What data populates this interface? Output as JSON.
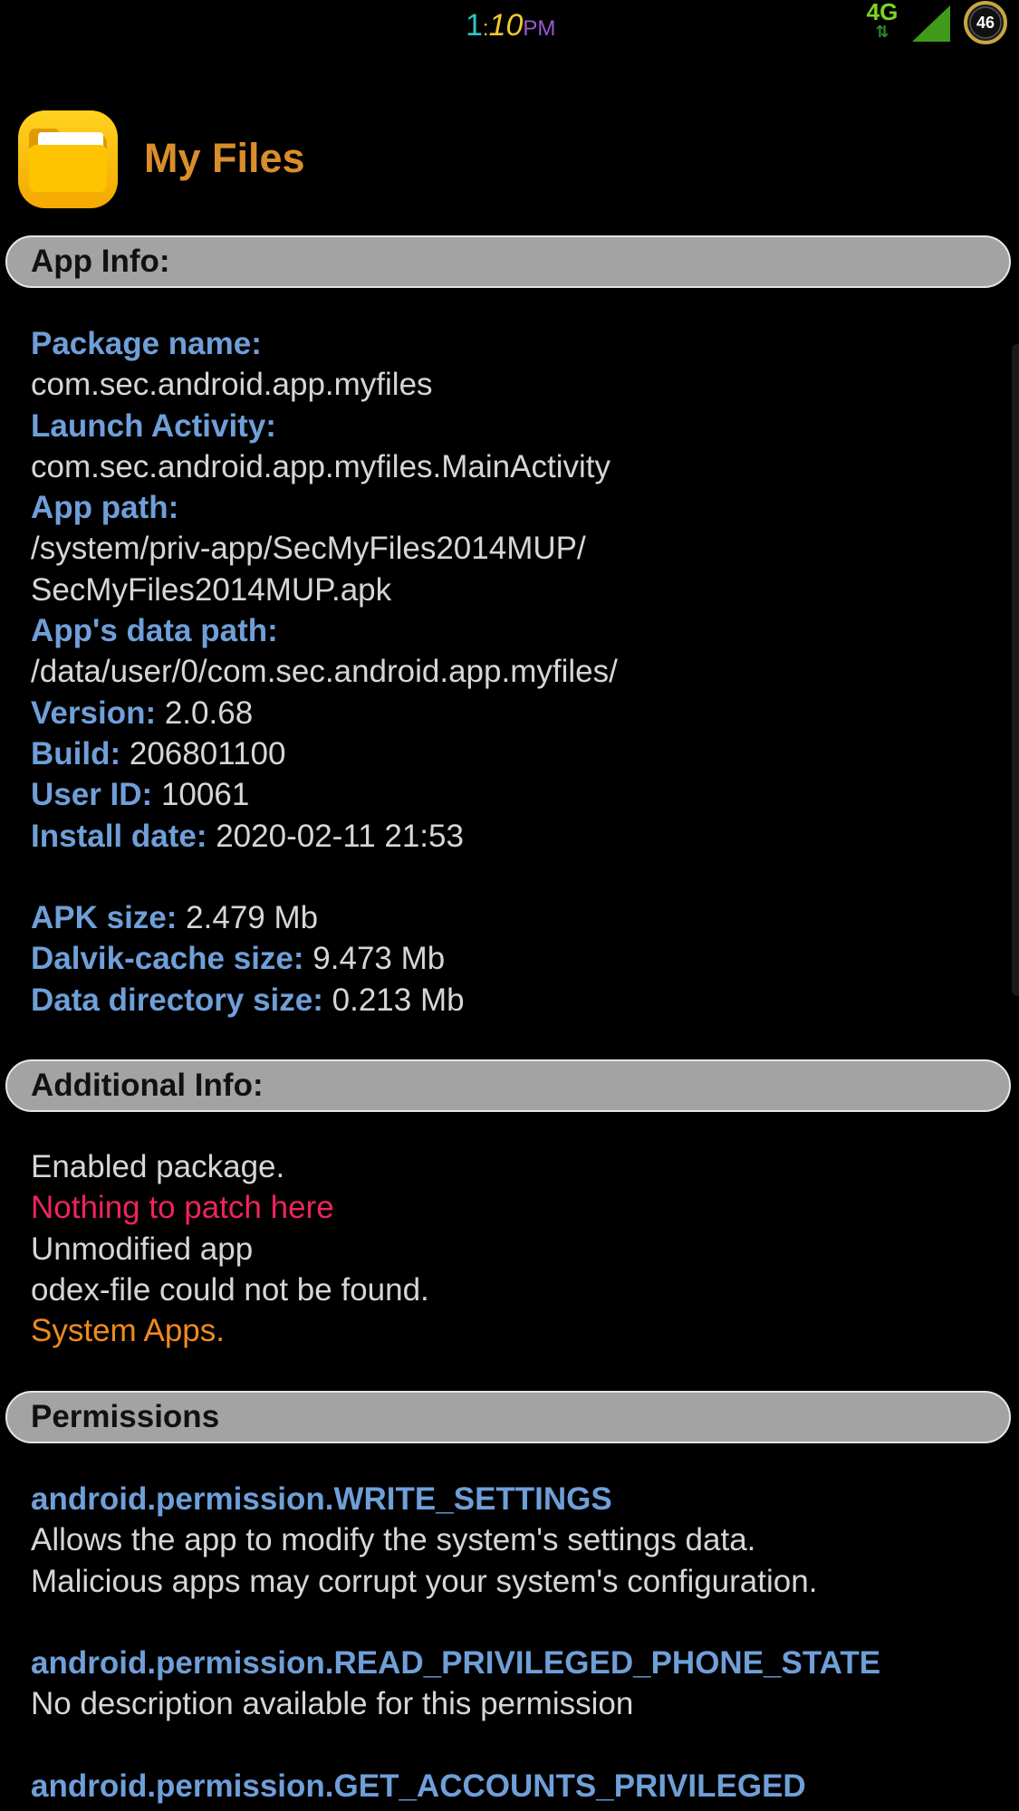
{
  "status_bar": {
    "clock_hour": "1",
    "clock_colon": ":",
    "clock_minute": "10",
    "clock_ampm": "PM",
    "network_type": "4G",
    "network_activity": "⇅",
    "battery_level": "46"
  },
  "app": {
    "name": "My Files",
    "icon": "folder-icon"
  },
  "app_info": {
    "section_title": "App Info:",
    "package_name_label": "Package name:",
    "package_name": "com.sec.android.app.myfiles",
    "launch_activity_label": "Launch Activity:",
    "launch_activity": "com.sec.android.app.myfiles.MainActivity",
    "app_path_label": "App path:",
    "app_path_line1": "/system/priv-app/SecMyFiles2014MUP/",
    "app_path_line2": "SecMyFiles2014MUP.apk",
    "data_path_label": "App's data path:",
    "data_path": "/data/user/0/com.sec.android.app.myfiles/",
    "version_label": "Version:",
    "version": "2.0.68",
    "build_label": "Build:",
    "build": "206801100",
    "user_id_label": "User ID:",
    "user_id": "10061",
    "install_date_label": "Install date:",
    "install_date": "2020-02-11 21:53",
    "apk_size_label": "APK size:",
    "apk_size": "2.479 Mb",
    "dalvik_size_label": "Dalvik-cache size:",
    "dalvik_size": "9.473 Mb",
    "data_dir_size_label": "Data directory size:",
    "data_dir_size": "0.213 Mb"
  },
  "additional_info": {
    "section_title": "Additional Info:",
    "lines": [
      "Enabled package.",
      "Nothing to patch here",
      "Unmodified app",
      "odex-file could not be found.",
      "System Apps."
    ]
  },
  "permissions": {
    "section_title": "Permissions",
    "items": [
      {
        "name": "android.permission.WRITE_SETTINGS",
        "description_line1": "Allows the app to modify the system's settings data.",
        "description_line2": "Malicious apps may corrupt your system's configuration."
      },
      {
        "name": "android.permission.READ_PRIVILEGED_PHONE_STATE",
        "description_line1": "No description available for this permission"
      },
      {
        "name": "android.permission.GET_ACCOUNTS_PRIVILEGED"
      }
    ]
  },
  "colors": {
    "background": "#000000",
    "label_blue": "#6f9fd8",
    "value_gray": "#d6d6d6",
    "title_orange": "#d98e2b",
    "warning_red": "#f0245b",
    "system_orange": "#f08a1e",
    "section_bar": "#a3a3a3"
  }
}
